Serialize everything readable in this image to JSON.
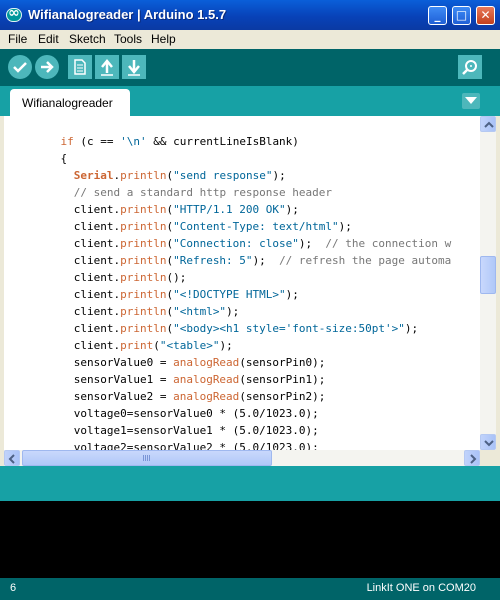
{
  "window": {
    "title": "Wifianalogreader | Arduino 1.5.7",
    "minimize_glyph": "_",
    "maximize_glyph": "□",
    "close_glyph": "✕"
  },
  "menu": [
    "File",
    "Edit",
    "Sketch",
    "Tools",
    "Help"
  ],
  "toolbar": {
    "buttons": [
      "verify-icon",
      "upload-icon",
      "new-icon",
      "open-icon",
      "save-icon"
    ],
    "serial_monitor": "serial-monitor-icon"
  },
  "tabs": [
    {
      "label": "Wifianalogreader"
    }
  ],
  "code_lines": [
    [
      {
        "t": "    ",
        "c": ""
      },
      {
        "t": "if",
        "c": "kw-if"
      },
      {
        "t": " (c == ",
        "c": ""
      },
      {
        "t": "'\\n'",
        "c": "str"
      },
      {
        "t": " && currentLineIsBlank)",
        "c": ""
      }
    ],
    [
      {
        "t": "    {",
        "c": ""
      }
    ],
    [
      {
        "t": "      ",
        "c": ""
      },
      {
        "t": "Serial",
        "c": "obj"
      },
      {
        "t": ".",
        "c": ""
      },
      {
        "t": "println",
        "c": "fn"
      },
      {
        "t": "(",
        "c": ""
      },
      {
        "t": "\"send response\"",
        "c": "str"
      },
      {
        "t": ");",
        "c": ""
      }
    ],
    [
      {
        "t": "      ",
        "c": ""
      },
      {
        "t": "// send a standard http response header",
        "c": "cmt"
      }
    ],
    [
      {
        "t": "      client.",
        "c": ""
      },
      {
        "t": "println",
        "c": "fn"
      },
      {
        "t": "(",
        "c": ""
      },
      {
        "t": "\"HTTP/1.1 200 OK\"",
        "c": "str"
      },
      {
        "t": ");",
        "c": ""
      }
    ],
    [
      {
        "t": "      client.",
        "c": ""
      },
      {
        "t": "println",
        "c": "fn"
      },
      {
        "t": "(",
        "c": ""
      },
      {
        "t": "\"Content-Type: text/html\"",
        "c": "str"
      },
      {
        "t": ");",
        "c": ""
      }
    ],
    [
      {
        "t": "      client.",
        "c": ""
      },
      {
        "t": "println",
        "c": "fn"
      },
      {
        "t": "(",
        "c": ""
      },
      {
        "t": "\"Connection: close\"",
        "c": "str"
      },
      {
        "t": ");  ",
        "c": ""
      },
      {
        "t": "// the connection w",
        "c": "cmt"
      }
    ],
    [
      {
        "t": "      client.",
        "c": ""
      },
      {
        "t": "println",
        "c": "fn"
      },
      {
        "t": "(",
        "c": ""
      },
      {
        "t": "\"Refresh: 5\"",
        "c": "str"
      },
      {
        "t": ");  ",
        "c": ""
      },
      {
        "t": "// refresh the page automa",
        "c": "cmt"
      }
    ],
    [
      {
        "t": "      client.",
        "c": ""
      },
      {
        "t": "println",
        "c": "fn"
      },
      {
        "t": "();",
        "c": ""
      }
    ],
    [
      {
        "t": "      client.",
        "c": ""
      },
      {
        "t": "println",
        "c": "fn"
      },
      {
        "t": "(",
        "c": ""
      },
      {
        "t": "\"<!DOCTYPE HTML>\"",
        "c": "str"
      },
      {
        "t": ");",
        "c": ""
      }
    ],
    [
      {
        "t": "      client.",
        "c": ""
      },
      {
        "t": "println",
        "c": "fn"
      },
      {
        "t": "(",
        "c": ""
      },
      {
        "t": "\"<html>\"",
        "c": "str"
      },
      {
        "t": ");",
        "c": ""
      }
    ],
    [
      {
        "t": "      client.",
        "c": ""
      },
      {
        "t": "println",
        "c": "fn"
      },
      {
        "t": "(",
        "c": ""
      },
      {
        "t": "\"<body><h1 style='font-size:50pt'>\"",
        "c": "str"
      },
      {
        "t": ");",
        "c": ""
      }
    ],
    [
      {
        "t": "      client.",
        "c": ""
      },
      {
        "t": "print",
        "c": "fn"
      },
      {
        "t": "(",
        "c": ""
      },
      {
        "t": "\"<table>\"",
        "c": "str"
      },
      {
        "t": ");",
        "c": ""
      }
    ],
    [
      {
        "t": "      sensorValue0 = ",
        "c": ""
      },
      {
        "t": "analogRead",
        "c": "fn"
      },
      {
        "t": "(sensorPin0);",
        "c": ""
      }
    ],
    [
      {
        "t": "      sensorValue1 = ",
        "c": ""
      },
      {
        "t": "analogRead",
        "c": "fn"
      },
      {
        "t": "(sensorPin1);",
        "c": ""
      }
    ],
    [
      {
        "t": "      sensorValue2 = ",
        "c": ""
      },
      {
        "t": "analogRead",
        "c": "fn"
      },
      {
        "t": "(sensorPin2);",
        "c": ""
      }
    ],
    [
      {
        "t": "      voltage0=sensorValue0 * (5.0/1023.0);",
        "c": ""
      }
    ],
    [
      {
        "t": "      voltage1=sensorValue1 * (5.0/1023.0);",
        "c": ""
      }
    ],
    [
      {
        "t": "      voltage2=sensorValue2 * (5.0/1023.0);",
        "c": ""
      }
    ]
  ],
  "status": {
    "line": "6",
    "board": "LinkIt ONE on COM20"
  },
  "colors": {
    "teal_dark": "#006468",
    "teal_mid": "#17a1a5",
    "button": "#4db7bb",
    "keyword": "#cc6633",
    "string": "#006699",
    "comment": "#777777"
  }
}
